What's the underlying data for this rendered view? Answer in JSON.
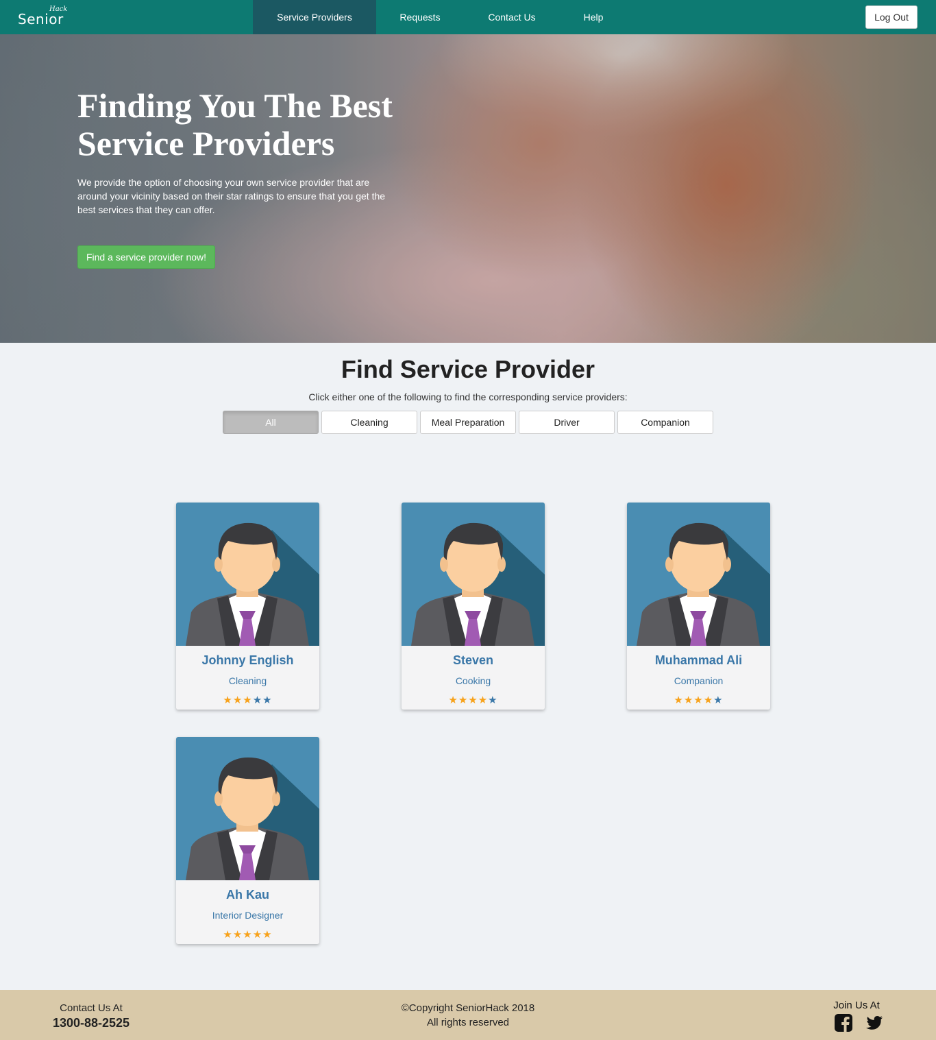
{
  "nav": {
    "brand_main": "Senior",
    "brand_sup": "Hack",
    "items": [
      {
        "label": "Service Providers",
        "active": true
      },
      {
        "label": "Requests",
        "active": false
      },
      {
        "label": "Contact Us",
        "active": false
      },
      {
        "label": "Help",
        "active": false
      }
    ],
    "logout_label": "Log Out"
  },
  "hero": {
    "title": "Finding You The Best Service Providers",
    "text": "We provide the option of choosing your own service provider that are around your vicinity based on their star ratings to ensure that you get the best services that they can offer.",
    "button_label": "Find a service provider now!"
  },
  "find": {
    "title": "Find Service Provider",
    "subtitle": "Click either one of the following to find the corresponding service providers:",
    "filters": [
      {
        "label": "All",
        "active": true
      },
      {
        "label": "Cleaning",
        "active": false
      },
      {
        "label": "Meal Preparation",
        "active": false
      },
      {
        "label": "Driver",
        "active": false
      },
      {
        "label": "Companion",
        "active": false
      }
    ]
  },
  "providers": [
    {
      "name": "Johnny English",
      "service": "Cleaning",
      "rating": 3,
      "max_rating": 5
    },
    {
      "name": "Steven",
      "service": "Cooking",
      "rating": 4,
      "max_rating": 5
    },
    {
      "name": "Muhammad Ali",
      "service": "Companion",
      "rating": 4,
      "max_rating": 5
    },
    {
      "name": "Ah Kau",
      "service": "Interior Designer",
      "rating": 5,
      "max_rating": 5
    }
  ],
  "footer": {
    "contact_label": "Contact Us At",
    "phone": "1300-88-2525",
    "copyright": "©Copyright SeniorHack 2018",
    "rights": "All rights reserved",
    "join_label": "Join Us At",
    "social_icons": [
      "facebook-icon",
      "twitter-icon"
    ]
  },
  "colors": {
    "nav_bg": "#0d7a72",
    "nav_active_bg": "#1b5862",
    "cta_green": "#5cb85c",
    "star_on": "#f7a21b",
    "star_off": "#3a77a8",
    "footer_bg": "#d9c9a9",
    "card_text": "#3a77a8"
  }
}
